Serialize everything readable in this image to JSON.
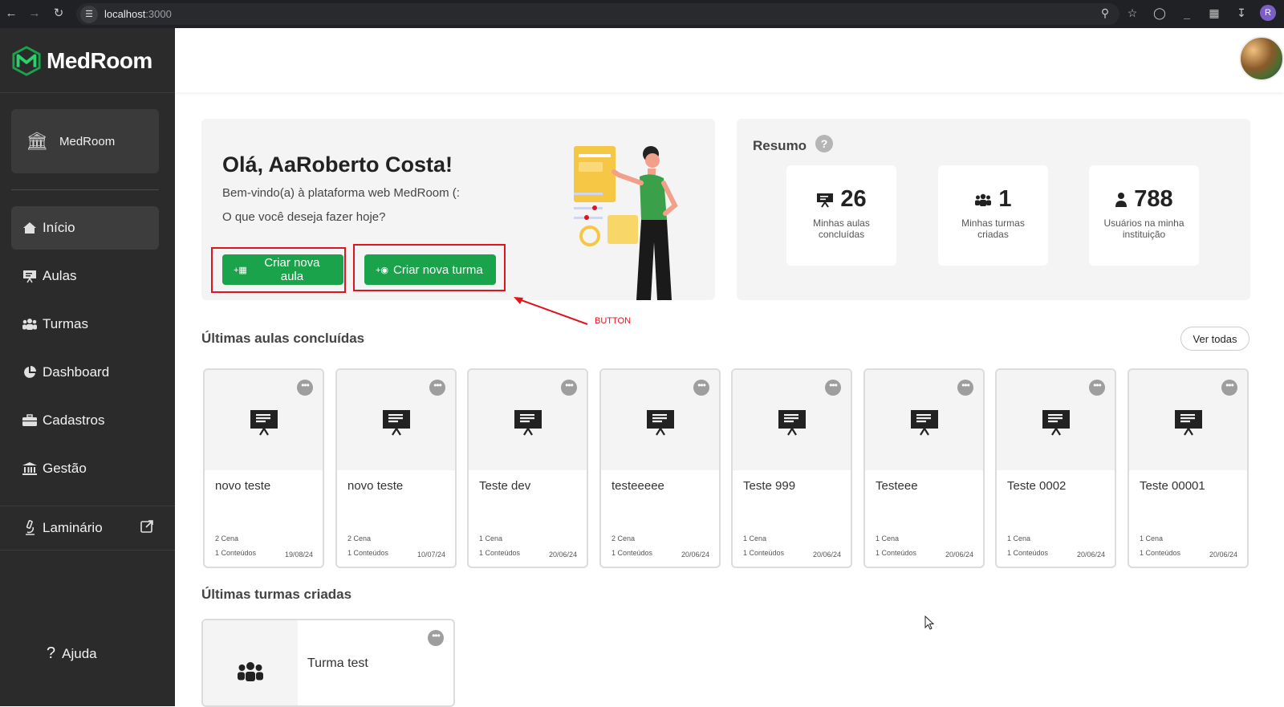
{
  "browser": {
    "url_host": "localhost",
    "url_port": ":3000",
    "profile_initial": "R"
  },
  "sidebar": {
    "brand": "MedRoom",
    "institution": "MedRoom",
    "items": [
      {
        "label": "Início",
        "icon": "home-icon",
        "active": true
      },
      {
        "label": "Aulas",
        "icon": "presentation-icon",
        "active": false
      },
      {
        "label": "Turmas",
        "icon": "users-icon",
        "active": false
      },
      {
        "label": "Dashboard",
        "icon": "pie-chart-icon",
        "active": false
      },
      {
        "label": "Cadastros",
        "icon": "briefcase-icon",
        "active": false
      },
      {
        "label": "Gestão",
        "icon": "bank-icon",
        "active": false
      }
    ],
    "laminario": "Laminário",
    "help": "Ajuda"
  },
  "welcome": {
    "title": "Olá, AaRoberto Costa!",
    "subtitle": "Bem-vindo(a) à plataforma web MedRoom (:",
    "question": "O que você deseja fazer hoje?",
    "btn_new_lesson": "Criar nova aula",
    "btn_new_class": "Criar nova turma"
  },
  "annotation": {
    "label": "BUTTON",
    "color": "#e0141c"
  },
  "summary": {
    "title": "Resumo",
    "help": "?",
    "stats": [
      {
        "value": "26",
        "label": "Minhas aulas concluídas",
        "icon": "presentation-icon"
      },
      {
        "value": "1",
        "label": "Minhas turmas criadas",
        "icon": "users-icon"
      },
      {
        "value": "788",
        "label": "Usuários na minha instituição",
        "icon": "user-icon"
      }
    ]
  },
  "lessons": {
    "title": "Últimas aulas concluídas",
    "see_all": "Ver todas",
    "items": [
      {
        "name": "novo teste",
        "scenes": "2 Cena",
        "contents": "1 Conteúdos",
        "date": "19/08/24"
      },
      {
        "name": "novo teste",
        "scenes": "2 Cena",
        "contents": "1 Conteúdos",
        "date": "10/07/24"
      },
      {
        "name": "Teste dev",
        "scenes": "1 Cena",
        "contents": "1 Conteúdos",
        "date": "20/06/24"
      },
      {
        "name": "testeeeee",
        "scenes": "2 Cena",
        "contents": "1 Conteúdos",
        "date": "20/06/24"
      },
      {
        "name": "Teste 999",
        "scenes": "1 Cena",
        "contents": "1 Conteúdos",
        "date": "20/06/24"
      },
      {
        "name": "Testeee",
        "scenes": "1 Cena",
        "contents": "1 Conteúdos",
        "date": "20/06/24"
      },
      {
        "name": "Teste 0002",
        "scenes": "1 Cena",
        "contents": "1 Conteúdos",
        "date": "20/06/24"
      },
      {
        "name": "Teste 00001",
        "scenes": "1 Cena",
        "contents": "1 Conteúdos",
        "date": "20/06/24"
      }
    ]
  },
  "classes": {
    "title": "Últimas turmas criadas",
    "items": [
      {
        "name": "Turma test"
      }
    ]
  },
  "colors": {
    "sidebar_bg": "#2b2b2b",
    "accent_green": "#1aa34a",
    "card_bg": "#f4f4f4",
    "annotation_red": "#e0141c"
  }
}
